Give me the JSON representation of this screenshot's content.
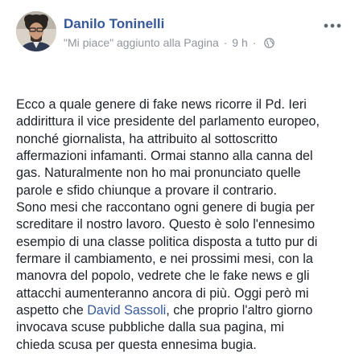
{
  "post": {
    "author": "Danilo Toninelli",
    "activity": "\"Mi piace\" aggiunto alla Pagina",
    "separator": "·",
    "time": "9 h",
    "separator2": "·",
    "privacy_icon": "globe-icon",
    "more_icon": "more-options-icon",
    "avatar_icon": "profile-photo"
  },
  "text": {
    "l1": "Ecco a quale genere di fake news ricorre il Pd. Ieri",
    "l2": "addirittura il vice presidente del parlamento europeo,",
    "l3": "nonché giornalista, ha attribuito al sottoscritto",
    "l4": "affermazioni infamanti. Ormai stanno alla canna del",
    "l5": "gas. Naturalmente non ho mai pronunciato quelle",
    "l6": "parole e sfido chiunque a provare il contrario.",
    "l7": "Sono mesi che raccontano ogni genere di bugia per",
    "l8": "screditare il nostro lavoro. Questo è solo l'ennesimo",
    "l9": "esempio di una classe politica disposta a tutto pur di",
    "l10": "fermare il cambiamento, e nei prossimi mesi, con la",
    "l11": "manovra del popolo, vedrete che le fake news e gli",
    "l12": "attacchi aumenteranno ancora di più. Oggi però mi",
    "l13_pre": "aspetto che ",
    "l13_link": "David Sassoli",
    "l13_post": ", che proprio l'altro giorno",
    "l14": "invocava scuse pubbliche dalla sua pagina, mi",
    "l15": "chieda scusa per questa ennesima bugia."
  },
  "colors": {
    "link": "#365899",
    "meta": "#90949c",
    "text": "#1d2129"
  }
}
